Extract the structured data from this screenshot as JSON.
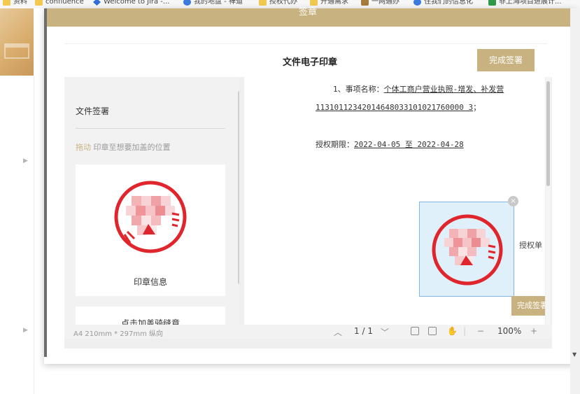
{
  "bookmarks": [
    {
      "label": "资料",
      "icon": "folder-icon"
    },
    {
      "label": "confluence",
      "icon": "folder-icon"
    },
    {
      "label": "Welcome to Jira -...",
      "icon": "jira-icon"
    },
    {
      "label": "我的地盘 - 禅道",
      "icon": "globe-icon"
    },
    {
      "label": "授权代办",
      "icon": "folder-icon"
    },
    {
      "label": "开通需求",
      "icon": "folder-icon"
    },
    {
      "label": "一网通办",
      "icon": "car-icon"
    },
    {
      "label": "住我们的信息化",
      "icon": "globe-icon"
    },
    {
      "label": "非上海项目进展计...",
      "icon": "grid-icon"
    }
  ],
  "modal": {
    "header_title": "签章",
    "doc_title": "文件电子印章",
    "finish_button": "完成签署"
  },
  "sidepanel": {
    "title": "文件签署",
    "hint_accent": "拖动",
    "hint_text": "印章至想要加盖的位置",
    "seal_label": "印章信息",
    "stitch_label": "点击加盖骑缝章"
  },
  "document": {
    "line1_prefix": "1、事项名称：",
    "line1_item": "个体工商户营业执照-增发、补发营",
    "line2_code": "11310112342014648033101021760000 3",
    "line2_suffix": "；",
    "auth_label": "授权期限：",
    "auth_period": "2022-04-05 至 2022-04-28",
    "side_text": "授权单",
    "close_symbol": "×",
    "finish_small": "完成签署"
  },
  "footer": {
    "paper_size": "A4 210mm * 297mm 纵向",
    "page_current": "1",
    "page_sep": "/",
    "page_total": "1",
    "zoom": "100%",
    "zoom_out": "−",
    "zoom_in": "+"
  },
  "colors": {
    "accent": "#c8b27f",
    "seal_red": "#e0262d",
    "selection_fill": "#dff0fb",
    "selection_border": "#7fb6e2"
  }
}
